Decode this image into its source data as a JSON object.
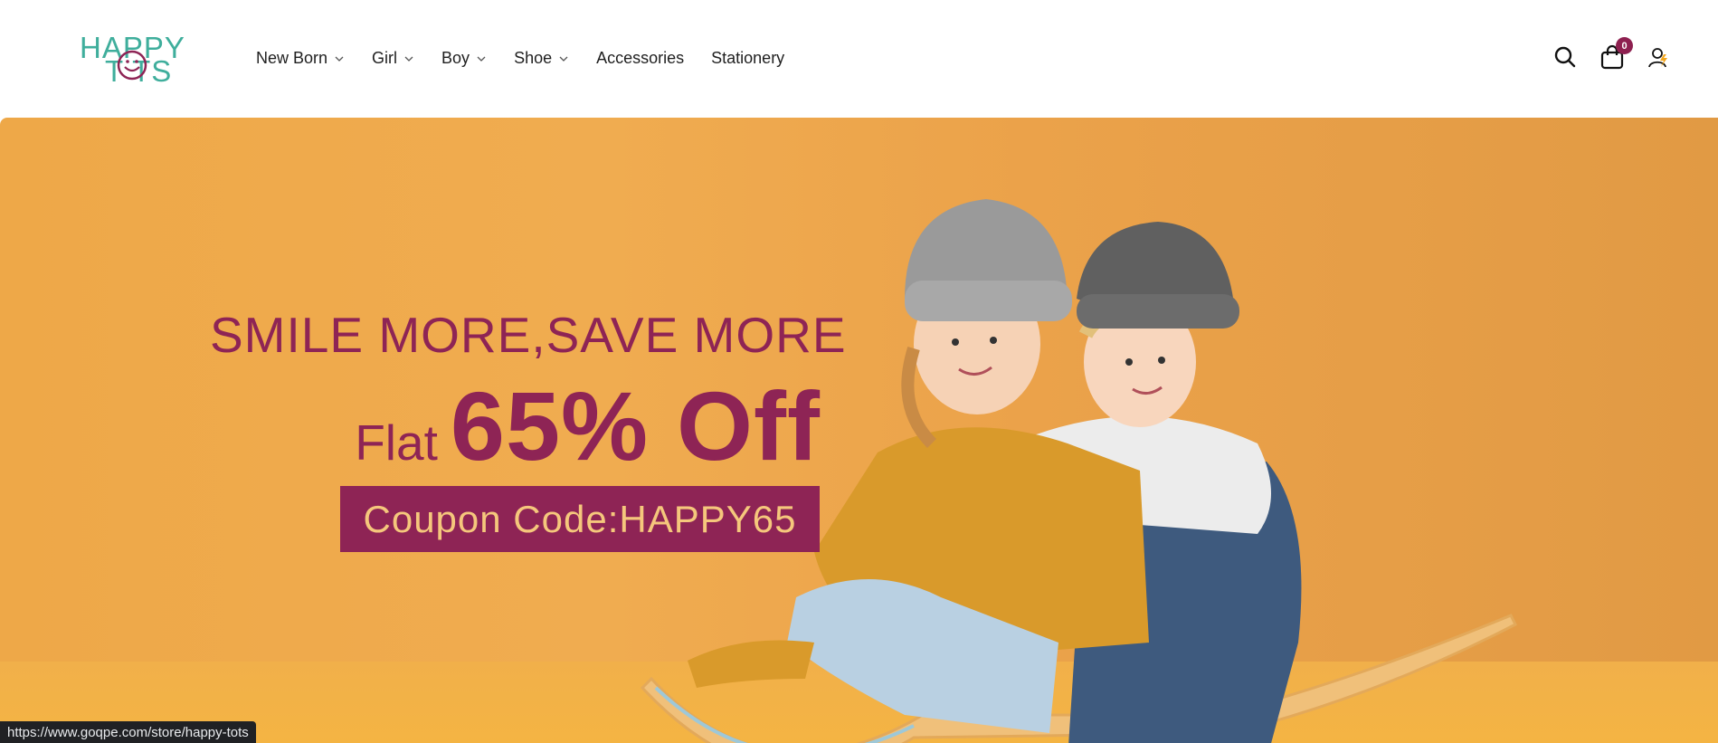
{
  "brand": {
    "line1": "HAPPY",
    "line2": "T  TS"
  },
  "nav": {
    "items": [
      {
        "label": "New Born",
        "has_dropdown": true
      },
      {
        "label": "Girl",
        "has_dropdown": true
      },
      {
        "label": "Boy",
        "has_dropdown": true
      },
      {
        "label": "Shoe",
        "has_dropdown": true
      },
      {
        "label": "Accessories",
        "has_dropdown": false
      },
      {
        "label": "Stationery",
        "has_dropdown": false
      }
    ]
  },
  "header_icons": {
    "search": "search-icon",
    "cart": "shopping-bag-icon",
    "cart_count": "0",
    "account": "user-icon"
  },
  "hero": {
    "headline": "SMILE MORE,SAVE MORE",
    "flat_label": "Flat",
    "discount": "65% Off",
    "coupon": "Coupon Code:HAPPY65"
  },
  "status_bar": {
    "url": "https://www.goqpe.com/store/happy-tots"
  },
  "colors": {
    "brand_teal": "#3fae9c",
    "accent_maroon": "#8e2455",
    "hero_orange": "#eea848",
    "coupon_text": "#f5c77c"
  }
}
